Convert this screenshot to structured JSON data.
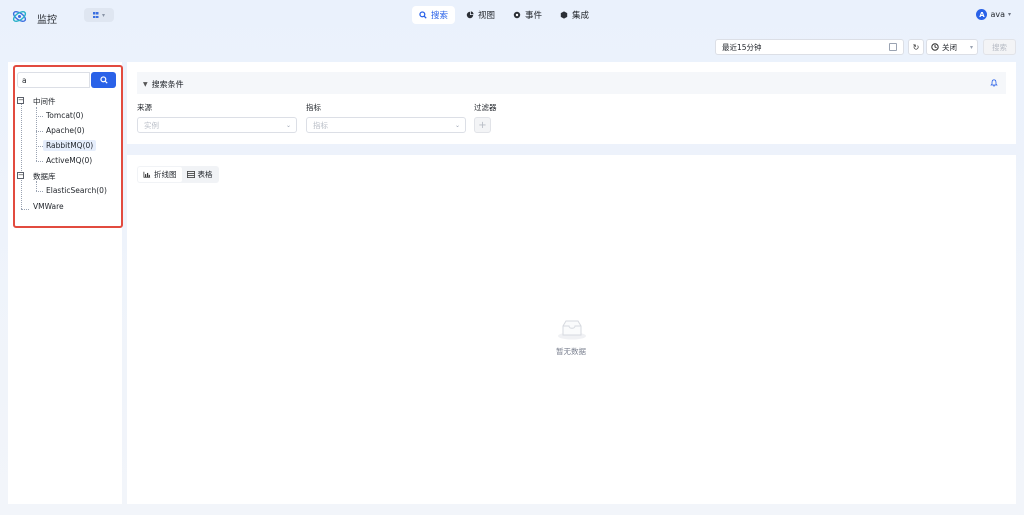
{
  "header": {
    "app_title": "监控",
    "nav": [
      {
        "label": "搜索",
        "icon": "search-icon",
        "active": true
      },
      {
        "label": "视图",
        "icon": "pie-chart-icon",
        "active": false
      },
      {
        "label": "事件",
        "icon": "gear-event-icon",
        "active": false
      },
      {
        "label": "集成",
        "icon": "cube-icon",
        "active": false
      }
    ],
    "user": {
      "avatar_letter": "A",
      "name": "ava"
    }
  },
  "toolbar": {
    "time_range": "最近15分钟",
    "auto_refresh": "关闭",
    "search_label": "搜索"
  },
  "tree": {
    "search_value": "a",
    "nodes": [
      {
        "label": "中间件",
        "expanded": true,
        "children": [
          {
            "label": "Tomcat(0)"
          },
          {
            "label": "Apache(0)"
          },
          {
            "label": "RabbitMQ(0)",
            "selected": true
          },
          {
            "label": "ActiveMQ(0)"
          }
        ]
      },
      {
        "label": "数据库",
        "expanded": true,
        "children": [
          {
            "label": "ElasticSearch(0)"
          }
        ]
      },
      {
        "label": "VMWare"
      }
    ]
  },
  "conditions": {
    "title": "搜索条件",
    "fields": [
      {
        "label": "来源",
        "placeholder": "实例"
      },
      {
        "label": "指标",
        "placeholder": "指标"
      },
      {
        "label": "过滤器"
      }
    ]
  },
  "result": {
    "views": [
      {
        "label": "折线图",
        "icon": "line-chart-icon",
        "active": true
      },
      {
        "label": "表格",
        "icon": "table-icon",
        "active": false
      }
    ],
    "empty_text": "暂无数据"
  },
  "colors": {
    "accent": "#2a62e8",
    "highlight_border": "#e24b3f"
  }
}
